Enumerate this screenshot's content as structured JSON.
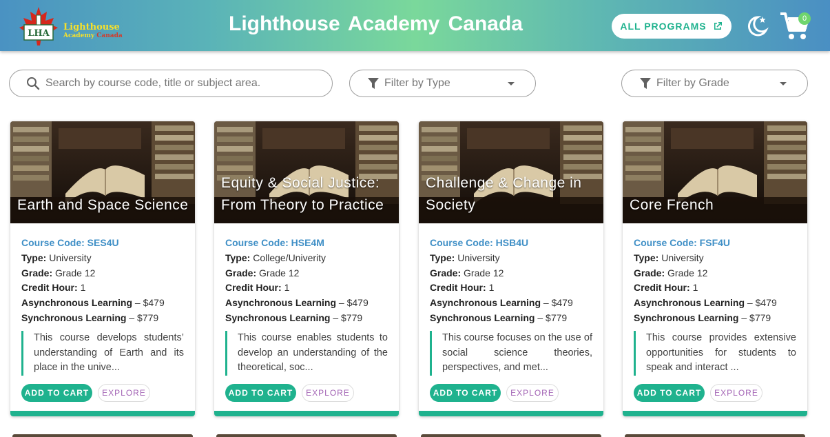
{
  "header": {
    "logo_mark": "LHA",
    "logo_line1": "Lighthouse",
    "logo_line2a": "Academy",
    "logo_line2b": "Canada",
    "title": "Lighthouse Academy Canada",
    "all_programs_label": "ALL PROGRAMS",
    "cart_count": "0",
    "icons": {
      "external": "external-link-icon",
      "theme": "moon-stars-icon",
      "cart": "cart-icon"
    }
  },
  "filters": {
    "search_placeholder": "Search by course code, title or subject area.",
    "search_value": "",
    "type_label": "Filter by Type",
    "grade_label": "Filter by Grade"
  },
  "colors": {
    "accent": "#1fb28e",
    "code": "#3f8fc6",
    "explore": "#a262b4"
  },
  "labels": {
    "type": "Type:",
    "grade": "Grade:",
    "credit": "Credit Hour:",
    "async": "Asynchronous Learning",
    "sync": "Synchronous Learning",
    "add_to_cart": "ADD TO CART",
    "explore": "EXPLORE"
  },
  "cards": [
    {
      "title": "Earth and Space Science",
      "code": "Course Code: SES4U",
      "type": "University",
      "grade": "Grade 12",
      "credit": "1",
      "async_price": " – $479",
      "sync_price": " – $779",
      "description": "This course develops students’ understanding of Earth and its place in the unive..."
    },
    {
      "title": "Equity & Social Justice: From Theory to Practice",
      "code": "Course Code: HSE4M",
      "type": "College/Univerity",
      "grade": "Grade 12",
      "credit": "1",
      "async_price": " – $479",
      "sync_price": " – $779",
      "description": "This course enables students to develop an understanding of the theoretical, soc..."
    },
    {
      "title": "Challenge & Change in Society",
      "code": "Course Code: HSB4U",
      "type": "University",
      "grade": "Grade 12",
      "credit": "1",
      "async_price": " – $479",
      "sync_price": " – $779",
      "description": "This course focuses on the use of social science theories, perspectives, and met..."
    },
    {
      "title": "Core French",
      "code": "Course Code: FSF4U",
      "type": "University",
      "grade": "Grade 12",
      "credit": "1",
      "async_price": " – $479",
      "sync_price": " – $779",
      "description": "This course provides extensive opportunities for students to speak and interact ..."
    }
  ]
}
